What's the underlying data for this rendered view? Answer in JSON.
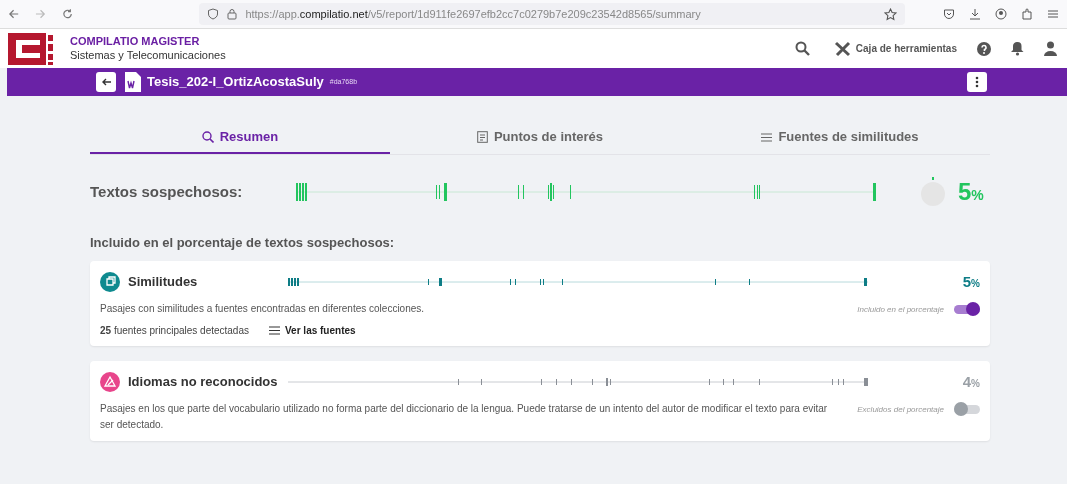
{
  "browser": {
    "url": "https://app.**compilatio.net**/v5/report/1d911fe2697efb2cc7c0279b7e209c23542d8565/summary"
  },
  "header": {
    "product": "COMPILATIO MAGISTER",
    "organization": "Sistemas y Telecomunicaciones",
    "toolbox": "Caja de herramientas"
  },
  "document": {
    "title": "Tesis_202-I_OrtizAcostaSuly",
    "tag": "#da768b"
  },
  "tabs": [
    {
      "label": "Resumen",
      "selected": true,
      "kind": "summary"
    },
    {
      "label": "Puntos de interés",
      "selected": false,
      "kind": "points"
    },
    {
      "label": "Fuentes de similitudes",
      "selected": false,
      "kind": "sources"
    }
  ],
  "suspicious": {
    "label": "Textos sospechosos:",
    "percent": "5",
    "unit": "%"
  },
  "included_heading": "Incluido en el porcentaje de textos sospechosos:",
  "cards": [
    {
      "kind": "similarity",
      "title": "Similitudes",
      "color": "#0e8a8f",
      "percent": "5",
      "unit": "%",
      "description": "Pasajes con similitudes a fuentes encontradas en diferentes colecciones.",
      "toggle_label": "Incluido en el porcentaje",
      "on": true,
      "sources_count": "25",
      "sources_text": "fuentes principales detectadas",
      "sources_link": "Ver las fuentes"
    },
    {
      "kind": "language",
      "title": "Idiomas no reconocidos",
      "color": "#e8458b",
      "percent": "4",
      "unit": "%",
      "description": "Pasajes en los que parte del vocabulario utilizado no forma parte del diccionario de la lengua. Puede tratarse de un intento del autor de modificar el texto para evitar ser detectado.",
      "toggle_label": "Excluidos del porcentaje",
      "on": false
    }
  ]
}
